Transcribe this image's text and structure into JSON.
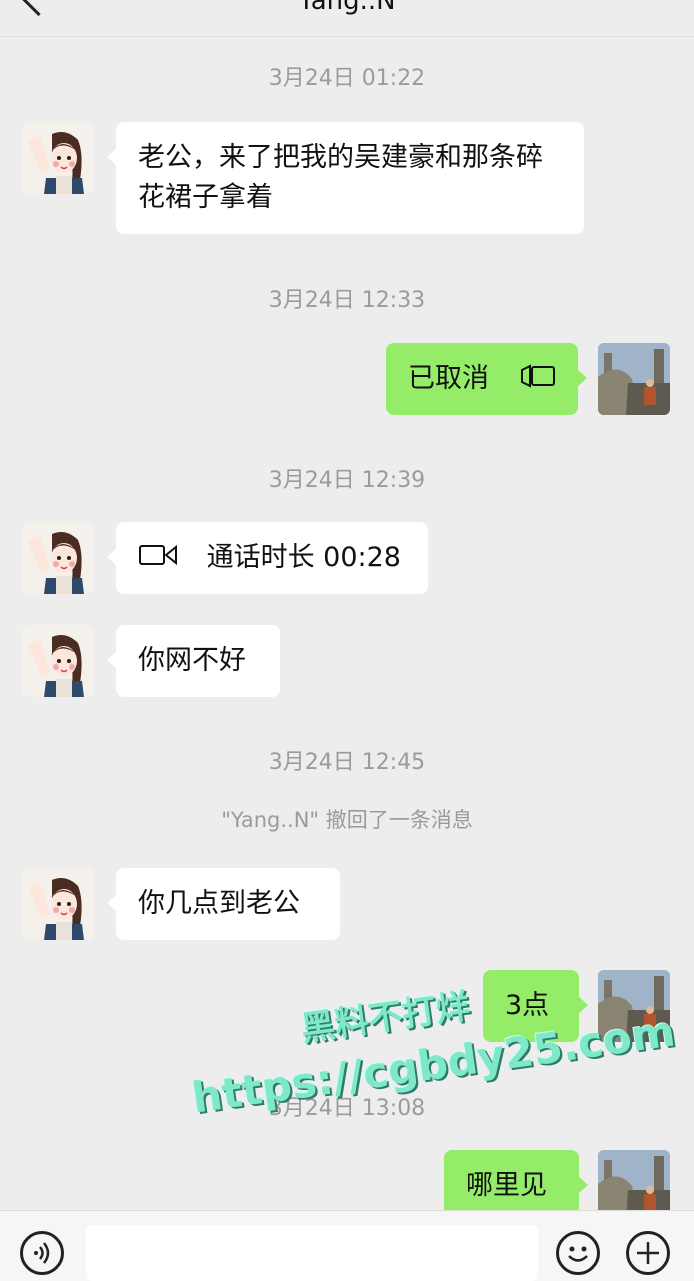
{
  "header": {
    "title": "Yang..N",
    "more": "···"
  },
  "messages": {
    "ts1": "3月24日 01:22",
    "m1": "老公，来了把我的吴建豪和那条碎花裙子拿着",
    "ts2": "3月24日 12:33",
    "m2": "已取消",
    "ts3": "3月24日 12:39",
    "m3": "通话时长 00:28",
    "m4": "你网不好",
    "ts4": "3月24日 12:45",
    "sys1": "\"Yang..N\" 撤回了一条消息",
    "m5": "你几点到老公",
    "m6": "3点",
    "ts5": "3月24日 13:08",
    "m7": "哪里见"
  },
  "watermark": {
    "line1": "黑料不打烊",
    "line2": "https://cgbdy25.com"
  },
  "icons": {
    "back": "back-chevron-icon",
    "video": "video-call-icon",
    "voice": "voice-icon",
    "emoji": "emoji-icon",
    "plus": "plus-icon"
  },
  "colors": {
    "sent_bubble": "#95ec69",
    "received_bubble": "#ffffff",
    "background": "#ededed"
  }
}
